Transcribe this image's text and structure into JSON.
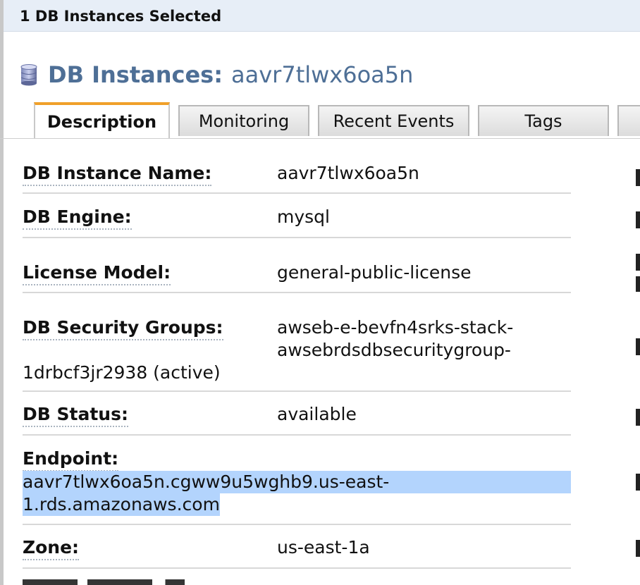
{
  "selection_bar": {
    "text": "1 DB Instances Selected"
  },
  "heading": {
    "prefix": "DB Instances:",
    "instance_id": "aavr7tlwx6oa5n",
    "icon": "database-icon"
  },
  "tabs": [
    {
      "label": "Description",
      "active": true
    },
    {
      "label": "Monitoring",
      "active": false
    },
    {
      "label": "Recent Events",
      "active": false
    },
    {
      "label": "Tags",
      "active": false
    }
  ],
  "details": {
    "instance_name": {
      "label": "DB Instance Name:",
      "value": "aavr7tlwx6oa5n"
    },
    "engine": {
      "label": "DB Engine:",
      "value": "mysql"
    },
    "license_model": {
      "label": "License Model:",
      "value": "general-public-license"
    },
    "security_groups": {
      "label": "DB Security Groups:",
      "value_line1": "awseb-e-bevfn4srks-stack-",
      "value_line2": "awsebrdsdbsecuritygroup-",
      "value_line3": "1drbcf3jr2938 (active)"
    },
    "status": {
      "label": "DB Status:",
      "value": "available"
    },
    "endpoint": {
      "label": "Endpoint:",
      "value_line1": "aavr7tlwx6oa5n.cgww9u5wghb9.us-east-",
      "value_line2": "1.rds.amazonaws.com"
    },
    "zone": {
      "label": "Zone:",
      "value": "us-east-1a"
    }
  },
  "colors": {
    "heading": "#4e6f96",
    "tab_accent": "#f0a02a",
    "selection_highlight": "#b3d4fd",
    "selection_bar_bg": "#e7eef7"
  }
}
